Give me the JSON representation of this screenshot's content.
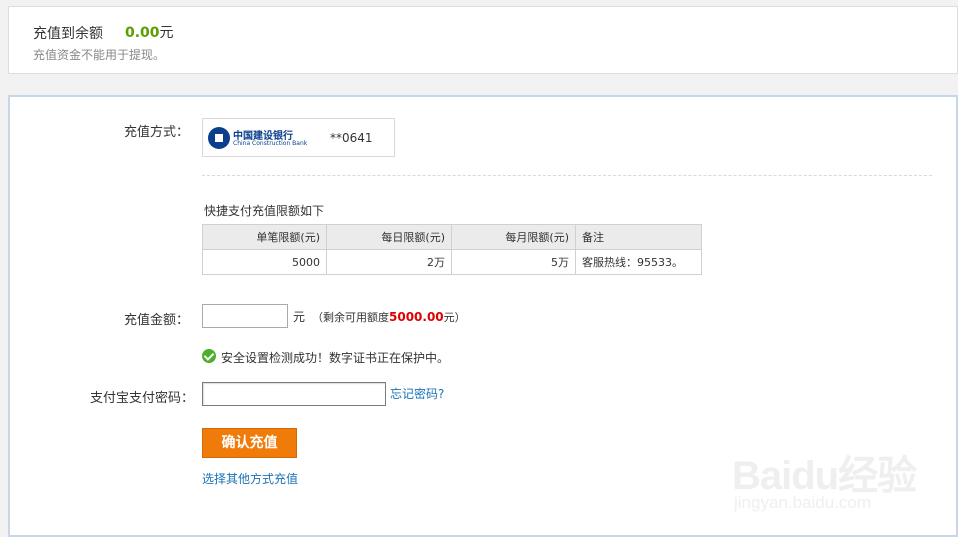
{
  "summary": {
    "title": "充值到余额",
    "amount": "0.00",
    "amount_unit": "元",
    "note": "充值资金不能用于提现。"
  },
  "form": {
    "method_label": "充值方式：",
    "bank": {
      "logo_cn": "中国建设银行",
      "logo_en": "China Construction Bank",
      "card_number": "**0641"
    },
    "limits": {
      "title": "快捷支付充值限额如下",
      "headers": [
        "单笔限额(元)",
        "每日限额(元)",
        "每月限额(元)",
        "备注"
      ],
      "rows": [
        [
          "5000",
          "2万",
          "5万",
          "客服热线：95533。"
        ]
      ]
    },
    "amount_label": "充值金额：",
    "amount_value": "",
    "amount_unit": "元",
    "remain_prefix": "（剩余可用额度",
    "remain_value": "5000.00",
    "remain_suffix": "元）",
    "security_text": "安全设置检测成功！数字证书正在保护中。",
    "password_label": "支付宝支付密码：",
    "password_value": "",
    "forgot_password": "忘记密码?",
    "confirm_button": "确认充值",
    "other_method_link": "选择其他方式充值"
  },
  "watermark": {
    "brand": "Baidu经验",
    "url": "jingyan.baidu.com"
  },
  "colors": {
    "amount_green": "#5a9e00",
    "remain_red": "#e00000",
    "link_blue": "#1a72b5",
    "button_orange": "#ef7c0a",
    "success_green": "#4caf2a"
  }
}
